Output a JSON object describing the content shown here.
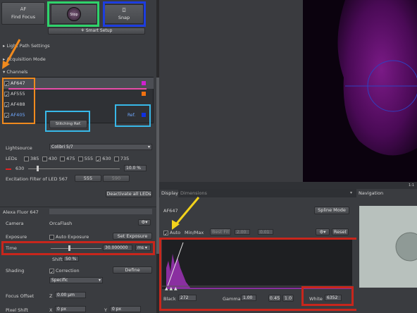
{
  "toolbar": {
    "find_focus": "Find Focus",
    "find_focus_icon": "AF",
    "stop": "Stop",
    "snap": "Snap",
    "smart_setup": "Smart Setup"
  },
  "sections": {
    "light_path": "Light Path Settings",
    "acquisition_mode": "Acquisition Mode",
    "channels": "Channels"
  },
  "channels": [
    {
      "name": "AF647",
      "checked": true,
      "color": "#d020d0"
    },
    {
      "name": "AF555",
      "checked": true,
      "color": "#f07010"
    },
    {
      "name": "AF488",
      "checked": true,
      "color": ""
    },
    {
      "name": "AF405",
      "checked": true,
      "color": "#1030e0"
    }
  ],
  "channel_tools": {
    "stitching_ref": "Stitching Ref.",
    "ref": "Ref."
  },
  "lightsource": {
    "label": "Lightsource",
    "value": "Colibri 5/7",
    "leds_label": "LEDs",
    "leds": [
      {
        "wl": "385",
        "checked": false
      },
      {
        "wl": "430",
        "checked": false
      },
      {
        "wl": "475",
        "checked": false
      },
      {
        "wl": "555",
        "checked": false
      },
      {
        "wl": "630",
        "checked": true
      },
      {
        "wl": "735",
        "checked": false
      }
    ],
    "active_led": "630",
    "intensity": "10.0 %",
    "excitation_label": "Excitation Filter of LED 567",
    "excitation_options": [
      "555",
      "590"
    ],
    "deactivate": "Deactivate all LEDs"
  },
  "camera_section": {
    "title": "Alexa Fluor 647",
    "camera_label": "Camera",
    "camera_value": "OrcaFlash",
    "exposure_label": "Exposure",
    "auto_exposure": "Auto Exposure",
    "set_exposure": "Set Exposure",
    "time_label": "Time",
    "time_value": "30.000000",
    "time_unit": "ms",
    "shift_label": "Shift",
    "shift_value": "50 %",
    "shading_label": "Shading",
    "correction": "Correction",
    "define": "Define",
    "shading_mode": "Specific",
    "focus_offset_label": "Focus Offset",
    "focus_z": "Z",
    "focus_value": "0.00 µm",
    "pixel_shift_label": "Pixel Shift",
    "pixel_x": "X",
    "pixel_x_value": "0 px",
    "pixel_y": "Y",
    "pixel_y_value": "0 px"
  },
  "display": {
    "tab_display": "Display",
    "tab_dimensions": "Dimensions",
    "channel": "AF647",
    "spline_mode": "Spline Mode",
    "auto": "Auto",
    "minmax": "Min/Max",
    "best_fit": "Best Fit",
    "bf_val1": "2.00",
    "bf_val2": "0.01",
    "reset": "Reset",
    "black_label": "Black",
    "black_value": "272",
    "gamma_label": "Gamma",
    "gamma_value": "1.00",
    "gamma_preset1": "0.45",
    "gamma_preset2": "1.0",
    "white_label": "White",
    "white_value": "6352"
  },
  "navigation": {
    "title": "Navigation"
  },
  "viewer": {
    "zoom_label": "1:1"
  }
}
